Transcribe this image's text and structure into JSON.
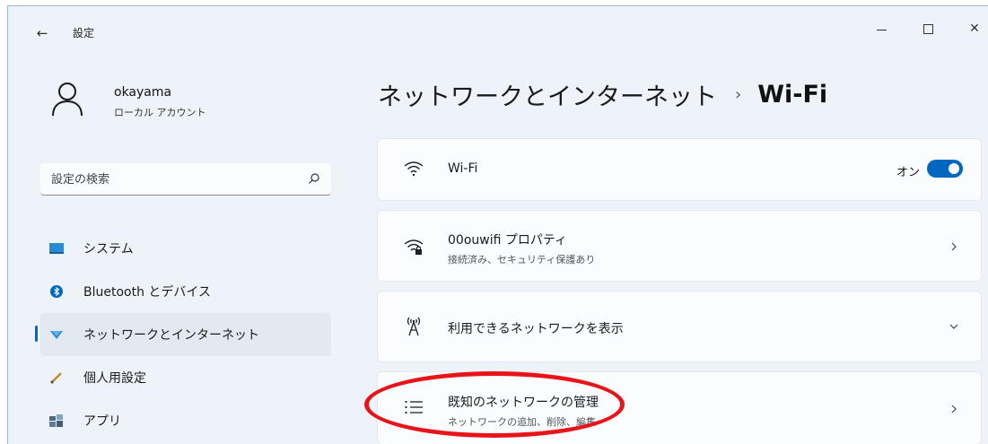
{
  "titlebar": {
    "back_glyph": "←",
    "title": "設定",
    "minimize_icon": "minimize-icon",
    "maximize_icon": "maximize-icon",
    "close_glyph": "✕"
  },
  "profile": {
    "name": "okayama",
    "account_type": "ローカル アカウント",
    "avatar_icon": "person-icon"
  },
  "search": {
    "placeholder": "設定の検索",
    "icon": "search-icon"
  },
  "nav": {
    "items": [
      {
        "label": "システム",
        "icon": "system-icon",
        "selected": false
      },
      {
        "label": "Bluetooth とデバイス",
        "icon": "bluetooth-icon",
        "selected": false
      },
      {
        "label": "ネットワークとインターネット",
        "icon": "network-icon",
        "selected": true
      },
      {
        "label": "個人用設定",
        "icon": "brush-icon",
        "selected": false
      },
      {
        "label": "アプリ",
        "icon": "apps-icon",
        "selected": false
      }
    ]
  },
  "breadcrumb": {
    "parent": "ネットワークとインターネット",
    "separator": "›",
    "current": "Wi-Fi"
  },
  "cards": {
    "wifi": {
      "title": "Wi-Fi",
      "toggle_label": "オン",
      "toggle_on": true,
      "icon": "wifi-icon"
    },
    "properties": {
      "title": "00ouwifi プロパティ",
      "subtitle": "接続済み、セキュリティ保護あり",
      "icon": "wifi-secure-icon"
    },
    "available": {
      "title": "利用できるネットワークを表示",
      "icon": "antenna-icon"
    },
    "known": {
      "title": "既知のネットワークの管理",
      "subtitle": "ネットワークの追加、削除、編集",
      "icon": "list-icon"
    }
  },
  "colors": {
    "accent": "#0067c0",
    "highlight_ellipse": "#e8141a",
    "window_bg": "#eef3f9",
    "card_bg": "#fbfcfe"
  }
}
